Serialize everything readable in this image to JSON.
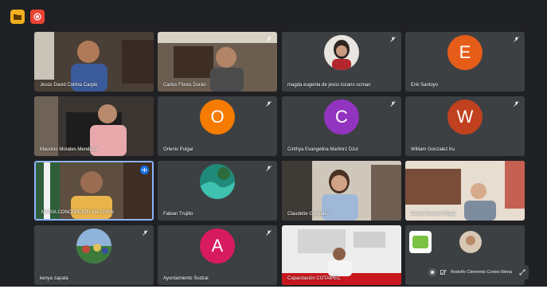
{
  "top_buttons": {
    "left_icon": "folder-icon",
    "right_icon": "record-icon"
  },
  "participants": [
    {
      "name": "Jesús David Colima Carpio"
    },
    {
      "name": "Carlos Flores Durán"
    },
    {
      "name": "magda eugenia de jesús lozano ocman"
    },
    {
      "name": "Erik Santoyo",
      "initial": "E",
      "color": "#e65c19"
    },
    {
      "name": "Mauricio Morales Mendoza"
    },
    {
      "name": "Orlenis Pulgar",
      "initial": "O",
      "color": "#f57c00"
    },
    {
      "name": "Cinthya Evangelina Martinrz Dzul",
      "initial": "C",
      "color": "#9334c0"
    },
    {
      "name": "William Gonzalez Ku",
      "initial": "W",
      "color": "#c1411f"
    },
    {
      "name": "MARIA CONCEPCION VIA CHAN"
    },
    {
      "name": "Fabian Trujillo"
    },
    {
      "name": "Claudette González"
    },
    {
      "name": "David Jiménez Rojas"
    },
    {
      "name": "kenya zapata"
    },
    {
      "name": "Ayuntamiento Sudzal",
      "initial": "A",
      "color": "#d81b60"
    },
    {
      "name": "Capacitación COTAIPEC"
    },
    {
      "name": ""
    }
  ],
  "pinned": {
    "name": "Rodolfo Clemente Cortes Mena"
  }
}
